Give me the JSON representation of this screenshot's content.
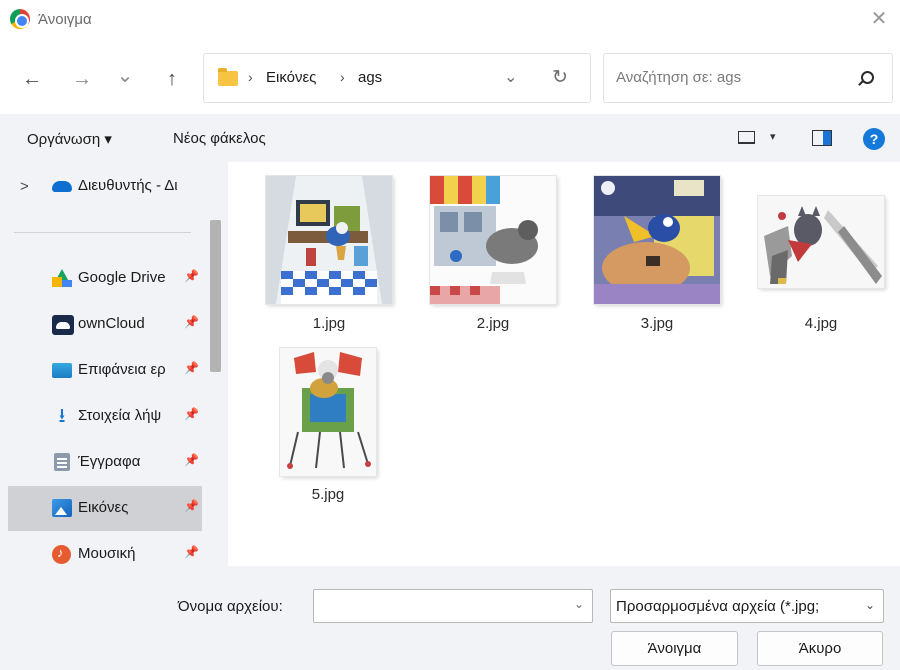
{
  "window": {
    "title": "Άνοιγμα",
    "close_glyph": "✕"
  },
  "nav": {
    "back_glyph": "←",
    "forward_glyph": "→",
    "recent_glyph": "⌄",
    "up_glyph": "↑",
    "breadcrumb": [
      "Εικόνες",
      "ags"
    ],
    "sep_glyph": "›",
    "addr_dropdown_glyph": "⌄",
    "refresh_glyph": "↻",
    "search_placeholder": "Αναζήτηση σε: ags"
  },
  "toolbar": {
    "organize_label": "Οργάνωση ▾",
    "new_folder_label": "Νέος φάκελος",
    "view_caret": "▾",
    "help_glyph": "?"
  },
  "sidebar": {
    "expand_glyph": ">",
    "items": [
      {
        "label": "Διευθυντής - Δι",
        "icon": "onedrive-icon",
        "pinned": false
      },
      {
        "label": "Google Drive",
        "icon": "google-drive-icon",
        "pinned": true
      },
      {
        "label": "ownCloud",
        "icon": "owncloud-icon",
        "pinned": true
      },
      {
        "label": "Επιφάνεια ερ",
        "icon": "desktop-icon",
        "pinned": true
      },
      {
        "label": "Στοιχεία λήψ",
        "icon": "download-icon",
        "pinned": true
      },
      {
        "label": "Έγγραφα",
        "icon": "documents-icon",
        "pinned": true
      },
      {
        "label": "Εικόνες",
        "icon": "pictures-icon",
        "pinned": true,
        "selected": true
      },
      {
        "label": "Μουσική",
        "icon": "music-icon",
        "pinned": true
      }
    ],
    "pin_glyph": "📌"
  },
  "files": [
    {
      "name": "1.jpg"
    },
    {
      "name": "2.jpg"
    },
    {
      "name": "3.jpg"
    },
    {
      "name": "4.jpg"
    },
    {
      "name": "5.jpg"
    }
  ],
  "footer": {
    "filename_label": "Όνομα αρχείου:",
    "filename_value": "",
    "filetype_value": "Προσαρμοσμένα αρχεία (*.jpg;",
    "dropdown_glyph": "⌄",
    "open_label": "Άνοιγμα",
    "cancel_label": "Άκυρο"
  },
  "colors": {
    "accent": "#1479d8",
    "panel": "#f1f3f6",
    "selected": "#cfd1d4"
  }
}
